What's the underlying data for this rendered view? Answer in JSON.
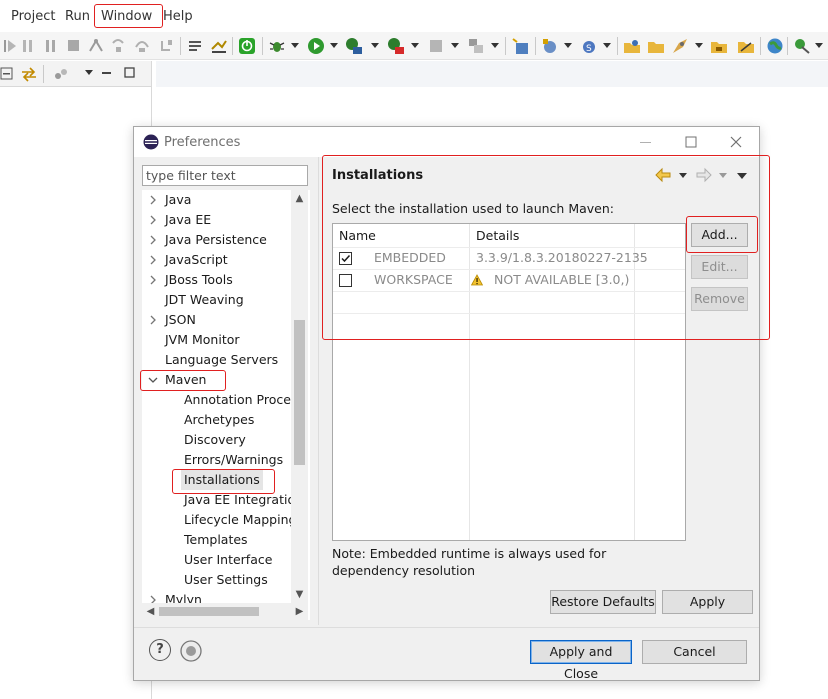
{
  "menubar": {
    "items": [
      "Project",
      "Run",
      "Window",
      "Help"
    ]
  },
  "dialog": {
    "title": "Preferences",
    "filter_placeholder": "type filter text",
    "tree": [
      {
        "label": "Java",
        "level": 0,
        "expander": "collapsed"
      },
      {
        "label": "Java EE",
        "level": 0,
        "expander": "collapsed"
      },
      {
        "label": "Java Persistence",
        "level": 0,
        "expander": "collapsed"
      },
      {
        "label": "JavaScript",
        "level": 0,
        "expander": "collapsed"
      },
      {
        "label": "JBoss Tools",
        "level": 0,
        "expander": "collapsed"
      },
      {
        "label": "JDT Weaving",
        "level": 0,
        "expander": "none"
      },
      {
        "label": "JSON",
        "level": 0,
        "expander": "collapsed"
      },
      {
        "label": "JVM Monitor",
        "level": 0,
        "expander": "none"
      },
      {
        "label": "Language Servers",
        "level": 0,
        "expander": "none"
      },
      {
        "label": "Maven",
        "level": 0,
        "expander": "expanded"
      },
      {
        "label": "Annotation Proces",
        "level": 1,
        "expander": "none"
      },
      {
        "label": "Archetypes",
        "level": 1,
        "expander": "none"
      },
      {
        "label": "Discovery",
        "level": 1,
        "expander": "none"
      },
      {
        "label": "Errors/Warnings",
        "level": 1,
        "expander": "none"
      },
      {
        "label": "Installations",
        "level": 1,
        "expander": "none",
        "selected": true
      },
      {
        "label": "Java EE Integratio",
        "level": 1,
        "expander": "none"
      },
      {
        "label": "Lifecycle Mapping",
        "level": 1,
        "expander": "none"
      },
      {
        "label": "Templates",
        "level": 1,
        "expander": "none"
      },
      {
        "label": "User Interface",
        "level": 1,
        "expander": "none"
      },
      {
        "label": "User Settings",
        "level": 1,
        "expander": "none"
      },
      {
        "label": "Mylyn",
        "level": 0,
        "expander": "collapsed"
      }
    ],
    "page": {
      "title": "Installations",
      "description": "Select the installation used to launch Maven:",
      "table": {
        "columns": [
          "Name",
          "Details"
        ],
        "rows": [
          {
            "checked": true,
            "name": "EMBEDDED",
            "details": "3.3.9/1.8.3.20180227-2135",
            "warning": false
          },
          {
            "checked": false,
            "name": "WORKSPACE",
            "details": "NOT AVAILABLE [3.0,)",
            "warning": true
          }
        ]
      },
      "buttons": {
        "add": "Add...",
        "edit": "Edit...",
        "remove": "Remove"
      },
      "note": "Note: Embedded runtime is always used for dependency resolution",
      "restore_defaults": "Restore Defaults",
      "apply": "Apply"
    },
    "apply_and_close": "Apply and Close",
    "cancel": "Cancel",
    "help_icon": "?"
  },
  "colors": {
    "annotation_red": "#e02020",
    "dialog_bg": "#f0f0f0",
    "default_button_border": "#0a64c8"
  }
}
